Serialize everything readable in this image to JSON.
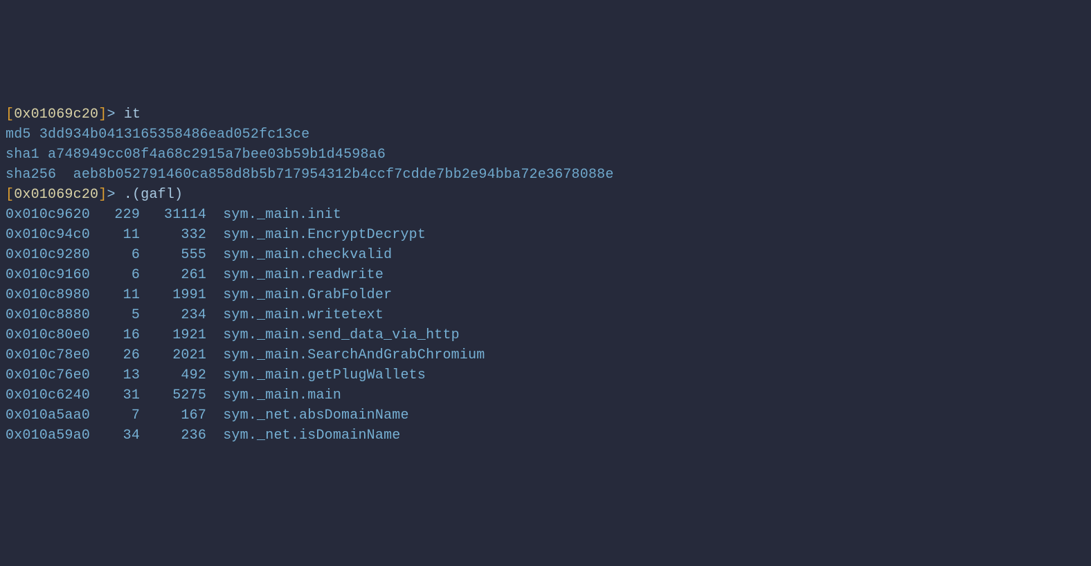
{
  "prompt": {
    "bracket_open": "[",
    "bracket_close": "]",
    "address": "0x01069c20",
    "gt": ">",
    "cmd1": "it",
    "cmd2": ".(gafl)"
  },
  "hashes": {
    "md5_label": "md5",
    "md5_value": "3dd934b0413165358486ead052fc13ce",
    "sha1_label": "sha1",
    "sha1_value": "a748949cc08f4a68c2915a7bee03b59b1d4598a6",
    "sha256_label": "sha256",
    "sha256_value": "aeb8b052791460ca858d8b5b717954312b4ccf7cdde7bb2e94bba72e3678088e"
  },
  "functions": [
    {
      "addr": "0x010c9620",
      "bb": "229",
      "size": "31114",
      "name": "sym._main.init"
    },
    {
      "addr": "0x010c94c0",
      "bb": "11",
      "size": "332",
      "name": "sym._main.EncryptDecrypt"
    },
    {
      "addr": "0x010c9280",
      "bb": "6",
      "size": "555",
      "name": "sym._main.checkvalid"
    },
    {
      "addr": "0x010c9160",
      "bb": "6",
      "size": "261",
      "name": "sym._main.readwrite"
    },
    {
      "addr": "0x010c8980",
      "bb": "11",
      "size": "1991",
      "name": "sym._main.GrabFolder"
    },
    {
      "addr": "0x010c8880",
      "bb": "5",
      "size": "234",
      "name": "sym._main.writetext"
    },
    {
      "addr": "0x010c80e0",
      "bb": "16",
      "size": "1921",
      "name": "sym._main.send_data_via_http"
    },
    {
      "addr": "0x010c78e0",
      "bb": "26",
      "size": "2021",
      "name": "sym._main.SearchAndGrabChromium"
    },
    {
      "addr": "0x010c76e0",
      "bb": "13",
      "size": "492",
      "name": "sym._main.getPlugWallets"
    },
    {
      "addr": "0x010c6240",
      "bb": "31",
      "size": "5275",
      "name": "sym._main.main"
    },
    {
      "addr": "0x010a5aa0",
      "bb": "7",
      "size": "167",
      "name": "sym._net.absDomainName"
    },
    {
      "addr": "0x010a59a0",
      "bb": "34",
      "size": "236",
      "name": "sym._net.isDomainName"
    }
  ]
}
